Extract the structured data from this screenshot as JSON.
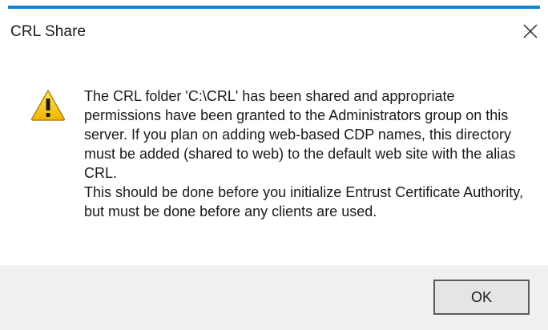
{
  "dialog": {
    "title": "CRL Share",
    "close_icon": "close-icon",
    "warning_icon": "warning-icon",
    "message_paragraph_1": "The CRL folder 'C:\\CRL' has been shared and appropriate permissions have been granted to the Administrators group on this server. If you plan on adding web-based CDP names, this directory must be added (shared to web) to the default web site with the alias CRL.",
    "message_paragraph_2": "This should be done before you initialize Entrust Certificate Authority, but must be done before any clients are used.",
    "ok_label": "OK"
  },
  "colors": {
    "accent": "#0a84d6",
    "footer_background": "#f0f0f0",
    "warning_yellow": "#f5c400"
  }
}
